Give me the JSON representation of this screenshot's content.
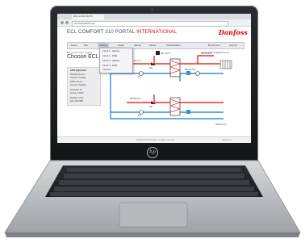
{
  "browser": {
    "tab_title": "ECL Comfort 310 Po",
    "address": "ecl.portal.danfoss.com"
  },
  "app": {
    "title_main": "ECL COMFORT 310 PORTAL",
    "title_accent": "INTERNATIONAL",
    "logo_text": "Danfoss"
  },
  "menu": {
    "items": [
      {
        "label": "Home"
      },
      {
        "label": "Info"
      },
      {
        "label": "Settings"
      },
      {
        "label": "Graph"
      },
      {
        "label": "Alarms"
      },
      {
        "label": "Values"
      },
      {
        "label": "Administration"
      },
      {
        "label": "My Account"
      },
      {
        "label": "Log out"
      }
    ],
    "dropdown": [
      "Circuit 1 - Heating",
      "Circuit 2 - DHW",
      "Circuit 3 - Heating",
      "Circuit 4 - DHW",
      "Common"
    ]
  },
  "page": {
    "breadcrumb": "ECL Comfort 310 > Settings",
    "title": "Choose ECL",
    "user": "User: portal.user@danfoss.com"
  },
  "panel": {
    "lines": [
      "A266 Application",
      "Heating Circuit 1",
      "Circuit 1: Heating",
      "DHW circuit 2",
      "Circuit 3: Heating",
      "Controller 14",
      "Circuit 4: DHW",
      "Weather comp.",
      "ECL 310 A266"
    ]
  },
  "diagram": {
    "labels": [
      "S3 25.7°C",
      "S1 4.9°C",
      "S2 44.0°C",
      "S4 55.3°C",
      "P1",
      "P2",
      "M1",
      "M2",
      "S5 40.2°C",
      "S6 22.1°C"
    ]
  },
  "footer": {
    "text": "Danfoss District Heating - All rights reserved",
    "version": "Version 1.2"
  },
  "colors": {
    "accent": "#e2000f",
    "hot_pipe": "#e8312f",
    "cold_pipe": "#3b8fd6"
  }
}
